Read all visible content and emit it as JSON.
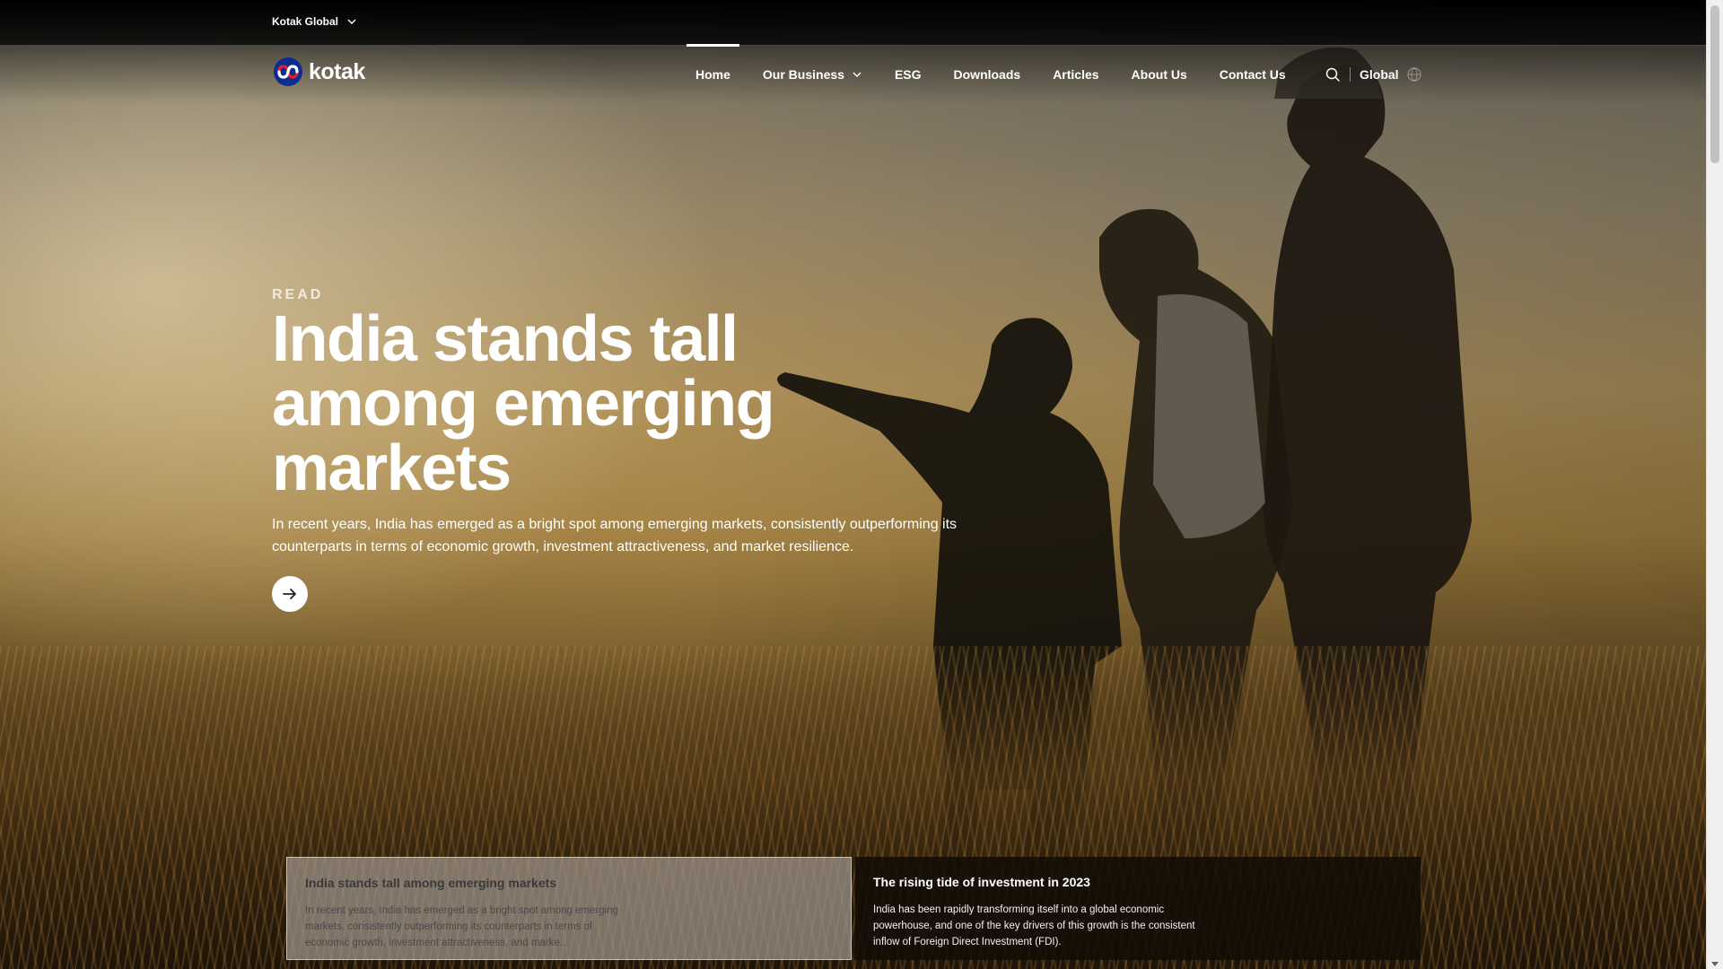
{
  "topbar": {
    "site_switch_label": "Kotak Global"
  },
  "brand": {
    "name": "kotak",
    "logo_icon": "kotak-infinity-logo-icon",
    "colors": {
      "logo_blue": "#0a2d8f",
      "logo_red": "#e31e24"
    }
  },
  "nav": {
    "items": [
      {
        "label": "Home",
        "active": true
      },
      {
        "label": "Our Business",
        "dropdown": true
      },
      {
        "label": "ESG"
      },
      {
        "label": "Downloads"
      },
      {
        "label": "Articles"
      },
      {
        "label": "About Us"
      },
      {
        "label": "Contact Us"
      }
    ],
    "search_icon": "search-icon",
    "language_label": "Global",
    "language_icon": "globe-icon"
  },
  "hero": {
    "eyebrow": "READ",
    "headline": "India stands tall among emerging markets",
    "lead": "In recent years, India has emerged as a bright spot among emerging markets, consistently outperforming its counterparts in terms of economic growth, investment attractiveness, and market resilience.",
    "cta_icon": "arrow-right-icon"
  },
  "cards": [
    {
      "title": "India stands tall among emerging markets",
      "text": "In recent years, India has emerged as a bright spot among emerging markets, consistently outperforming its counterparts in terms of economic growth, investment attractiveness, and marke...",
      "active": true
    },
    {
      "title": "The rising tide of investment in 2023",
      "text": "India has been rapidly transforming itself into a global economic powerhouse, and one of the key drivers of this growth is the consistent inflow of Foreign Direct Investment (FDI).",
      "active": false
    }
  ]
}
